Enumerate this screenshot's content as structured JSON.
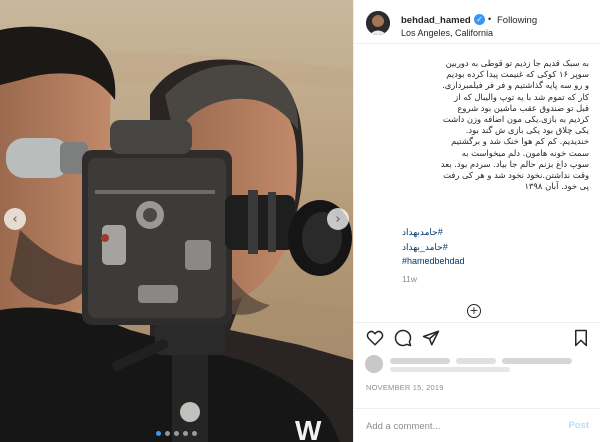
{
  "post": {
    "username": "behdad_hamed",
    "verified": true,
    "separator": "•",
    "follow_label": "Following",
    "location": "Los Angeles, California",
    "caption_lines": [
      "به سبک قدیم جا زدیم تو قوطی به دوربین",
      "سوپر ۱۶ کوکی که غنیمت پیدا کرده بودیم",
      "و رو سه پایه گذاشتیم و فر فر فیلمبرداری.",
      "کار که تموم شد با یه توپ والیبال که از",
      "قبل تو صندوق عقب ماشین بود شروع",
      "کردیم به بازی.یکی مون اضافه وزن داشت",
      "یکی چلاق بود یکی بازی ش گند بود.",
      "خندیدیم. کم کم هوا خنک شد و برگشتیم",
      "سمت خونه هامون. دلم میخواست به",
      "سوپ داغ بزنم حالم جا بیاد. سردم بود. بعد",
      "وقت نداشتن.نخود نخود شد و هر کی رفت",
      "پی خود. آبان ۱۳۹۸"
    ],
    "hashtags": [
      "#حامدبهداد",
      "#حامد_بهداد",
      "#hamedbehdad"
    ],
    "time_ago": "11w",
    "date": "NOVEMBER 15, 2019",
    "comment_placeholder": "Add a comment...",
    "post_label": "Post",
    "carousel_total": 5,
    "carousel_active": 1
  },
  "icons": {
    "like": "heart-icon",
    "comment": "comment-icon",
    "share": "share-icon",
    "save": "bookmark-icon",
    "verified": "verified-badge-icon",
    "prev": "chevron-left-icon",
    "next": "chevron-right-icon",
    "more": "plus-circle-icon"
  },
  "colors": {
    "link": "#00376b",
    "verified": "#3897f0",
    "muted": "#8e8e8e",
    "post_disabled": "#b2dffc"
  }
}
